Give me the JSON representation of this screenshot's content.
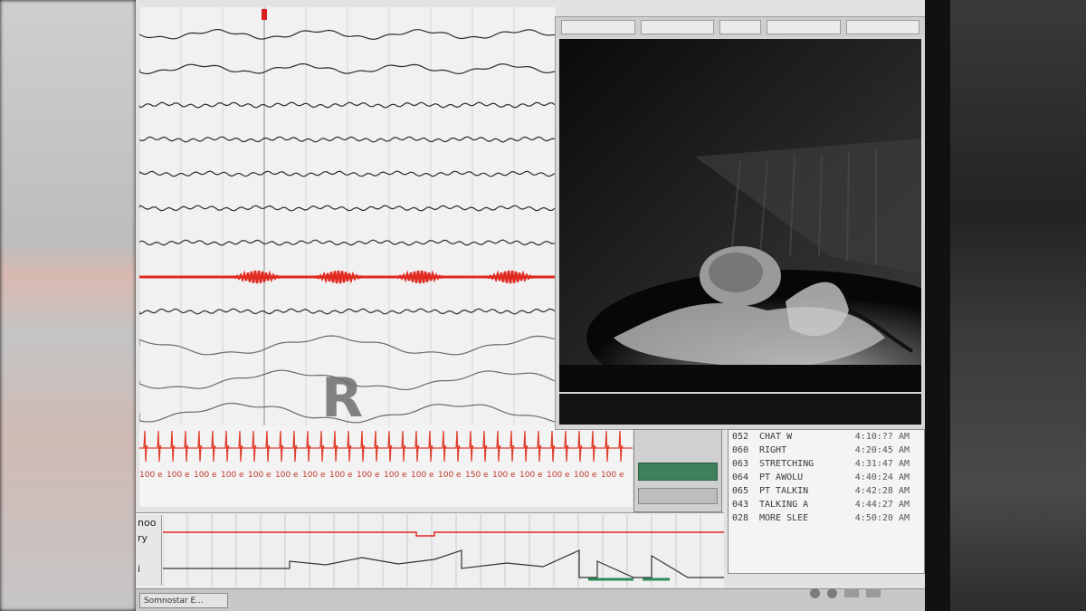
{
  "psg": {
    "stage_label": "R",
    "ecg_tick_labels": [
      "100 e",
      "100 e",
      "100 e",
      "100 e",
      "100 e",
      "100 e",
      "100 e",
      "100 e",
      "100 e",
      "100 e",
      "100 e",
      "100 e",
      "150 e",
      "100 e",
      "100 e",
      "100 e",
      "100 e",
      "100 e"
    ]
  },
  "hypnogram": {
    "labels": [
      "noo",
      "ry",
      "",
      "i",
      "i"
    ]
  },
  "events": [
    {
      "num": "052",
      "label": "CHAT W",
      "time": "4:10:?? AM"
    },
    {
      "num": "060",
      "label": "RIGHT",
      "time": "4:20:45 AM"
    },
    {
      "num": "063",
      "label": "STRETCHING",
      "time": "4:31:47 AM"
    },
    {
      "num": "064",
      "label": "PT AWOLU",
      "time": "4:40:24 AM"
    },
    {
      "num": "065",
      "label": "PT TALKIN",
      "time": "4:42:28 AM"
    },
    {
      "num": "043",
      "label": "TALKING A",
      "time": "4:44:27 AM"
    },
    {
      "num": "028",
      "label": "MORE SLEE",
      "time": "4:50:20 AM"
    }
  ],
  "taskbar": {
    "app_button": "Somnostar E..."
  },
  "colors": {
    "emg": "#e02a20",
    "ecg": "#e0402e",
    "trace": "#2d2d2d",
    "marker": "#d62020",
    "screen_bg": "#f1f1f1"
  },
  "icons": {
    "tray": [
      "speaker-icon",
      "network-icon",
      "clock-icon"
    ]
  }
}
